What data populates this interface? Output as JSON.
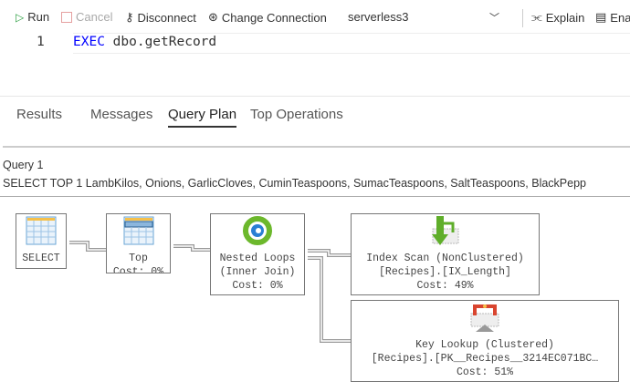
{
  "toolbar": {
    "run": "Run",
    "cancel": "Cancel",
    "disconnect": "Disconnect",
    "change_connection": "Change Connection",
    "database": "serverless3",
    "explain": "Explain",
    "enable": "Ena"
  },
  "editor": {
    "line_number": "1",
    "keyword": "EXEC",
    "code": " dbo.getRecord"
  },
  "tabs": [
    {
      "label": "Results"
    },
    {
      "label": "Messages"
    },
    {
      "label": "Query Plan",
      "active": true
    },
    {
      "label": "Top Operations"
    }
  ],
  "plan": {
    "query_title": "Query 1",
    "query_text": "SELECT TOP 1 LambKilos, Onions, GarlicCloves, CuminTeaspoons, SumacTeaspoons, SaltTeaspoons, BlackPepp",
    "nodes": [
      {
        "line1": "SELECT"
      },
      {
        "line1": "Top",
        "line2": "Cost: 0%"
      },
      {
        "line1": "Nested Loops",
        "line2": "(Inner Join)",
        "line3": "Cost: 0%"
      },
      {
        "line1": "Index Scan (NonClustered)",
        "line2": "[Recipes].[IX_Length]",
        "line3": "Cost: 49%"
      },
      {
        "line1": "Key Lookup (Clustered)",
        "line2": "[Recipes].[PK__Recipes__3214EC071BC…",
        "line3": "Cost: 51%"
      }
    ]
  },
  "colors": {
    "keyword": "#0000ff",
    "run": "#2ea043",
    "cancel": "#e5a0a0",
    "tab_underline": "#333333"
  }
}
